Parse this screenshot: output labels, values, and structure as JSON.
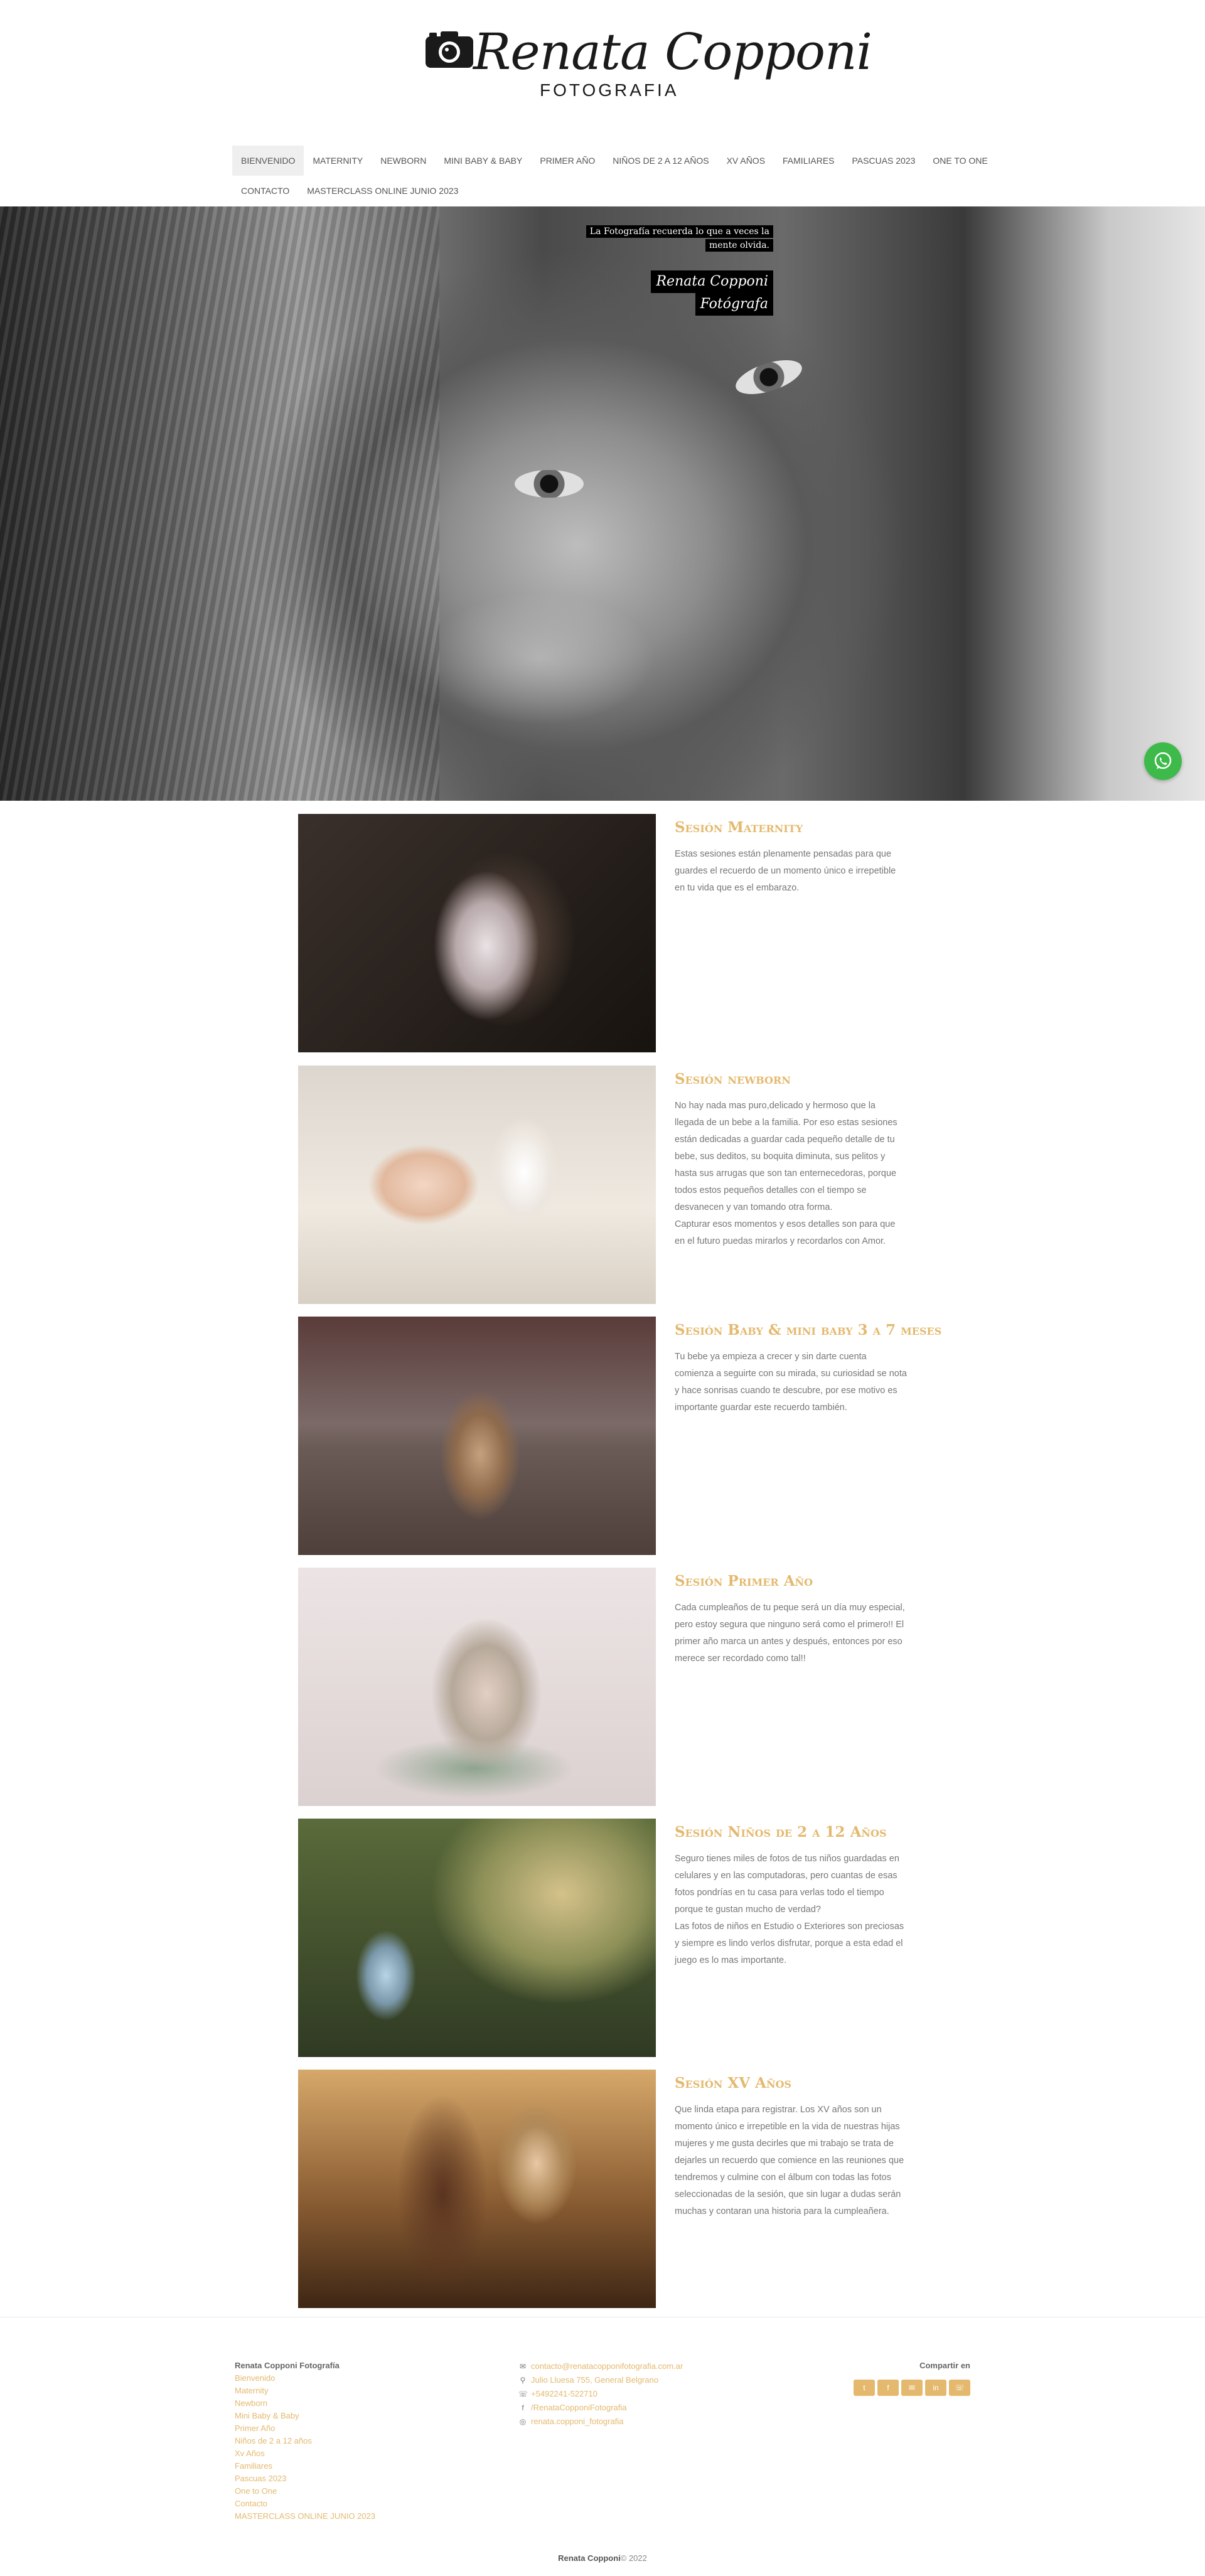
{
  "brand": {
    "name": "Renata Copponi",
    "subtitle": "FOTOGRAFIA",
    "accent_color": "#e4b96e",
    "icon": "camera-icon"
  },
  "nav": {
    "items": [
      {
        "label": "BIENVENIDO",
        "active": true
      },
      {
        "label": "MATERNITY"
      },
      {
        "label": "NEWBORN"
      },
      {
        "label": "MINI BABY & BABY"
      },
      {
        "label": "PRIMER AÑO"
      },
      {
        "label": "NIÑOS DE 2 A 12 AÑOS"
      },
      {
        "label": "XV AÑOS"
      },
      {
        "label": "FAMILIARES"
      },
      {
        "label": "PASCUAS 2023"
      },
      {
        "label": "ONE TO ONE"
      },
      {
        "label": "CONTACTO"
      },
      {
        "label": "MASTERCLASS ONLINE JUNIO 2023"
      }
    ]
  },
  "hero": {
    "quote_line1": "La Fotografía recuerda lo que a veces la",
    "quote_line2": "mente olvida.",
    "signature_line1": "Renata Copponi",
    "signature_line2": "Fotógrafa",
    "whatsapp_icon": "whatsapp-icon"
  },
  "sessions": [
    {
      "title": "Sesión Maternity",
      "description": "Estas sesiones están plenamente pensadas para que guardes el recuerdo de un momento único e irrepetible en tu vida que es el embarazo."
    },
    {
      "title": "Sesión newborn",
      "description": "No hay nada mas puro,delicado y hermoso que la llegada de un bebe a la familia. Por eso estas sesiones están dedicadas a guardar cada pequeño detalle de tu bebe, sus deditos, su boquita diminuta, sus pelitos y hasta sus arrugas que son tan enternecedoras, porque todos estos pequeños detalles con el tiempo se desvanecen y van tomando otra forma.\nCapturar esos momentos y esos detalles son para que en el futuro puedas mirarlos y recordarlos con Amor."
    },
    {
      "title": "Sesión Baby & mini baby 3 a 7 meses",
      "description": "Tu bebe ya empieza a crecer y sin darte cuenta comienza a seguirte con su mirada, su curiosidad se nota y hace sonrisas cuando te descubre, por ese motivo es importante guardar este recuerdo también."
    },
    {
      "title": "Sesión Primer Año",
      "description": "Cada cumpleaños de tu peque será un día muy especial, pero estoy segura que ninguno será como el primero!! El primer año marca un antes y después, entonces por eso merece ser recordado como tal!!"
    },
    {
      "title": "Sesión Niños de 2 a 12 Años",
      "description": "Seguro tienes miles de fotos de tus niños guardadas en celulares y en las computadoras, pero cuantas de esas fotos pondrías en tu casa para verlas todo el tiempo porque te gustan mucho de verdad?\nLas fotos de niños en Estudio o Exteriores son preciosas y siempre es lindo verlos disfrutar, porque a esta edad el juego es lo mas importante."
    },
    {
      "title": "Sesión XV Años",
      "description": "Que linda etapa para registrar. Los XV años son un momento único e irrepetible en la vida de nuestras hijas mujeres y me gusta decirles que mi trabajo se trata de dejarles un recuerdo que comience en las reuniones que tendremos y culmine con el álbum con todas las fotos seleccionadas de la sesión, que sin lugar a dudas serán muchas y contaran una historia para la cumpleañera."
    }
  ],
  "footer": {
    "site_title": "Renata Copponi Fotografía",
    "links": [
      "Bienvenido",
      "Maternity",
      "Newborn",
      "Mini Baby & Baby",
      "Primer Año",
      "Niños de 2 a 12 años",
      "Xv Años",
      "Familiares",
      "Pascuas 2023",
      "One to One",
      "Contacto",
      "MASTERCLASS ONLINE JUNIO 2023"
    ],
    "contact": {
      "email": "contacto@renatacopponifotografia.com.ar",
      "address": "Julio Lluesa 755, General Belgrano",
      "phone": "+5492241-522710",
      "facebook": "/RenataCopponiFotografia",
      "instagram": "renata.copponi_fotografia"
    },
    "share_label": "Compartir en",
    "share_icons": [
      "twitter-icon",
      "facebook-icon",
      "email-icon",
      "linkedin-icon",
      "whatsapp-icon"
    ],
    "copyright_name": "Renata Copponi",
    "copyright_year": "© 2022"
  }
}
